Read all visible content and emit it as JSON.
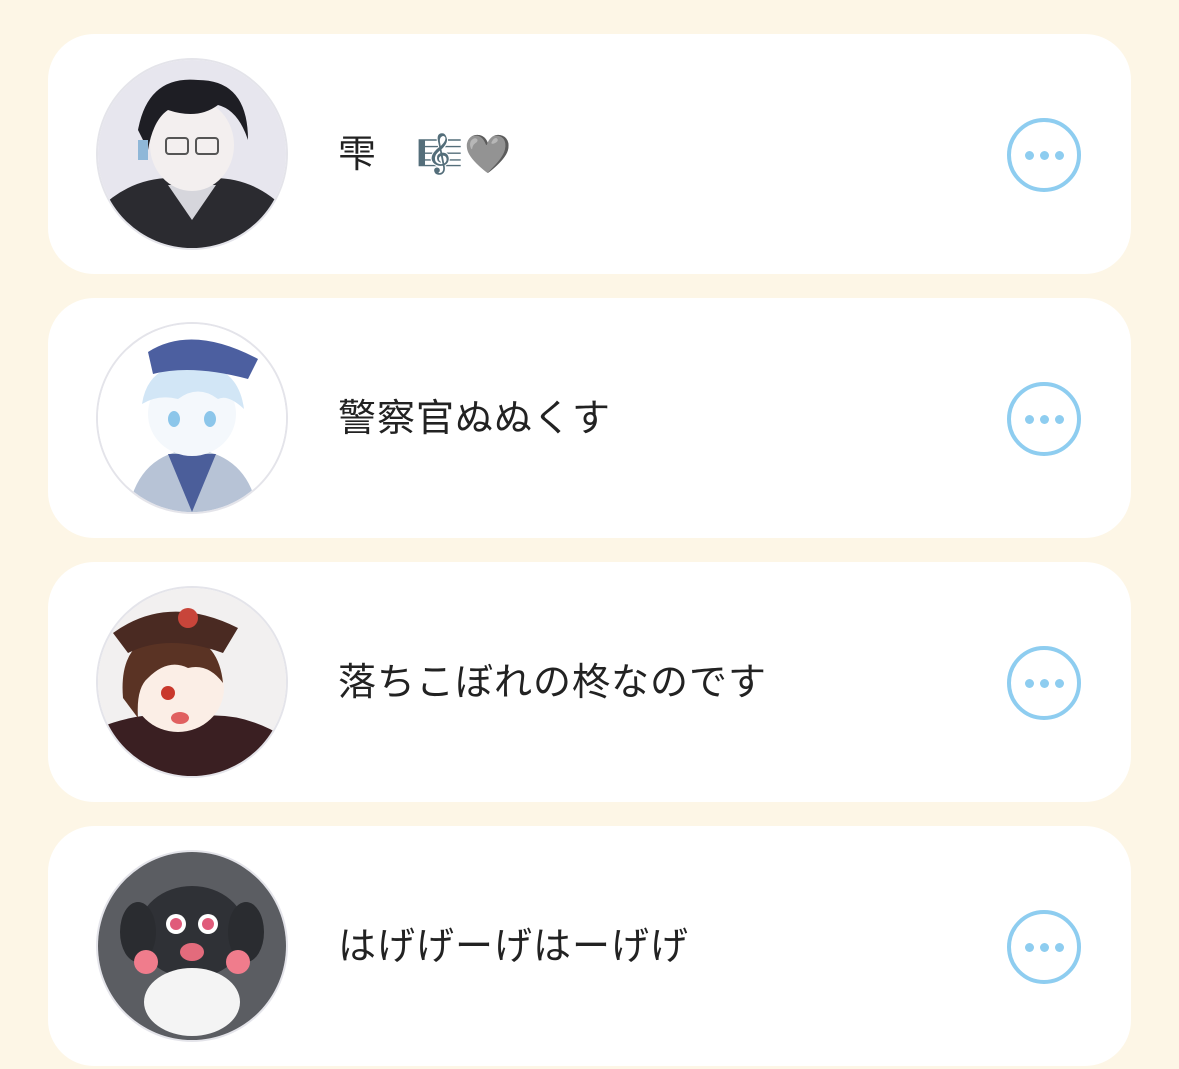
{
  "users": [
    {
      "name": "雫　🎼🩶",
      "avatar_icon": "avatar-boy-glasses-icon"
    },
    {
      "name": "警察官ぬぬくす",
      "avatar_icon": "avatar-police-girl-icon"
    },
    {
      "name": "落ちこぼれの柊なのです",
      "avatar_icon": "avatar-girl-hat-icon"
    },
    {
      "name": "はげげーげはーげげ",
      "avatar_icon": "avatar-puppy-icon"
    }
  ],
  "more_icon": "more-horizontal-icon",
  "colors": {
    "background": "#fdf6e6",
    "card": "#ffffff",
    "accent": "#8ecdf0",
    "text": "#222222"
  }
}
